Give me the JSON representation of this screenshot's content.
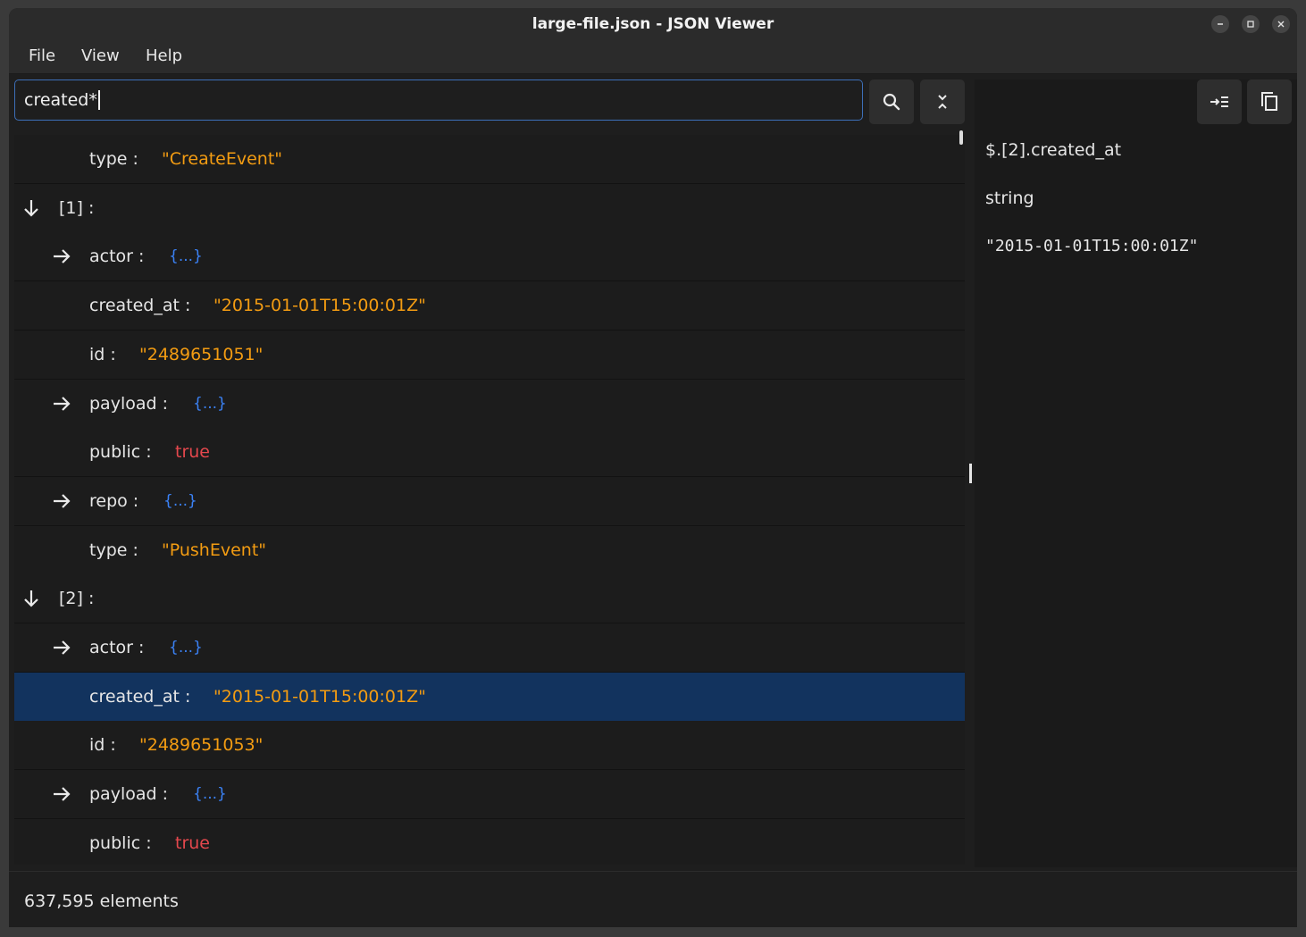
{
  "window": {
    "title": "large-file.json - JSON Viewer"
  },
  "menu": {
    "file": "File",
    "view": "View",
    "help": "Help"
  },
  "search": {
    "value": "created*"
  },
  "tree": {
    "rows": [
      {
        "key": "type :",
        "value": "\"CreateEvent\"",
        "kind": "string"
      },
      {
        "key": "[1] :",
        "value": "",
        "kind": "index",
        "expander": "down-arrow-icon"
      },
      {
        "key": "actor :",
        "value": "{...}",
        "kind": "object",
        "expander": "right-arrow-icon"
      },
      {
        "key": "created_at :",
        "value": "\"2015-01-01T15:00:01Z\"",
        "kind": "string"
      },
      {
        "key": "id :",
        "value": "\"2489651051\"",
        "kind": "string"
      },
      {
        "key": "payload :",
        "value": "{...}",
        "kind": "object",
        "expander": "right-arrow-icon"
      },
      {
        "key": "public :",
        "value": "true",
        "kind": "boolean"
      },
      {
        "key": "repo :",
        "value": "{...}",
        "kind": "object",
        "expander": "right-arrow-icon"
      },
      {
        "key": "type :",
        "value": "\"PushEvent\"",
        "kind": "string"
      },
      {
        "key": "[2] :",
        "value": "",
        "kind": "index",
        "expander": "down-arrow-icon"
      },
      {
        "key": "actor :",
        "value": "{...}",
        "kind": "object",
        "expander": "right-arrow-icon"
      },
      {
        "key": "created_at :",
        "value": "\"2015-01-01T15:00:01Z\"",
        "kind": "string",
        "selected": true
      },
      {
        "key": "id :",
        "value": "\"2489651053\"",
        "kind": "string"
      },
      {
        "key": "payload :",
        "value": "{...}",
        "kind": "object",
        "expander": "right-arrow-icon"
      },
      {
        "key": "public :",
        "value": "true",
        "kind": "boolean"
      }
    ]
  },
  "details": {
    "path": "$.[2].created_at",
    "type": "string",
    "value": "\"2015-01-01T15:00:01Z\""
  },
  "status": {
    "count": "637,595 elements"
  },
  "colors": {
    "string": "#f39c12",
    "boolean": "#e5484d",
    "object": "#3b82f6",
    "selection": "#12335e",
    "focus": "#3d6fb8"
  }
}
